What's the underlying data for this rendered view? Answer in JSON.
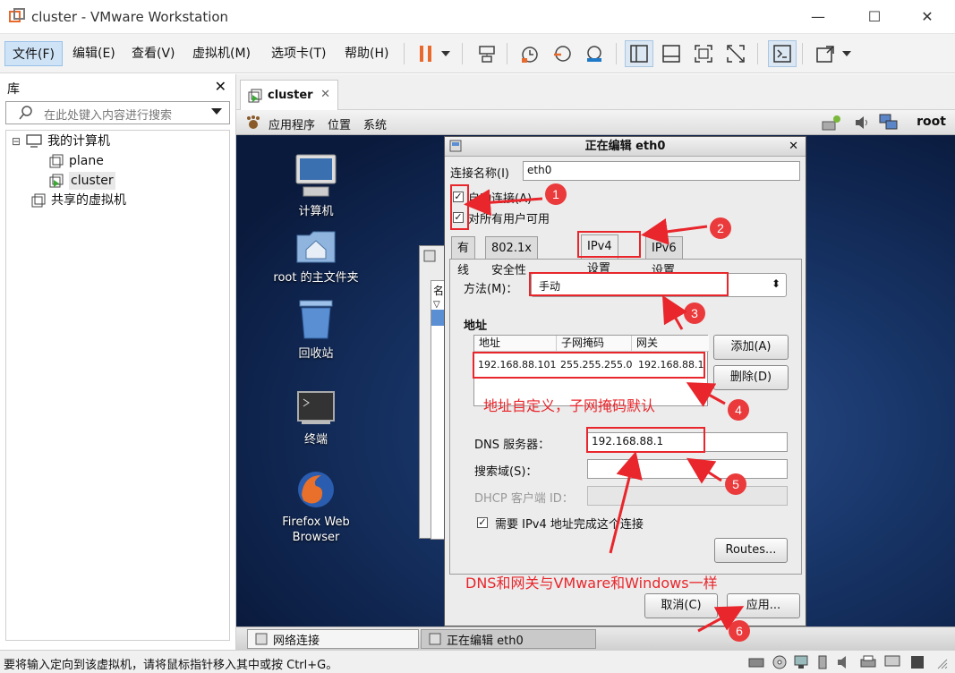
{
  "window": {
    "title": "cluster - VMware Workstation",
    "minimize": "—",
    "maximize": "☐",
    "close": "✕"
  },
  "menu": [
    "文件(F)",
    "编辑(E)",
    "查看(V)",
    "虚拟机(M)",
    "选项卡(T)",
    "帮助(H)"
  ],
  "library": {
    "title": "库",
    "close": "✕",
    "search_placeholder": "在此处键入内容进行搜索",
    "tree": {
      "root": "我的计算机",
      "collapse": "⊟",
      "vms": [
        "plane",
        "cluster"
      ],
      "shared": "共享的虚拟机"
    }
  },
  "vm_tab": {
    "label": "cluster",
    "close": "✕"
  },
  "guest": {
    "panel_menus": [
      "应用程序",
      "位置",
      "系统"
    ],
    "user": "root",
    "desktop_icons": [
      {
        "label": "计算机"
      },
      {
        "label": "root 的主文件夹"
      },
      {
        "label": "回收站"
      },
      {
        "label": "终端"
      },
      {
        "label": "Firefox Web\nBrowser"
      }
    ],
    "taskbar": [
      "网络连接",
      "正在编辑 eth0"
    ]
  },
  "bg_dialog": {
    "col_label": "名",
    "arrow": "▽"
  },
  "dialog": {
    "title": "正在编辑  eth0",
    "close": "✕",
    "conn_name_label": "连接名称(I)",
    "conn_name_value": "eth0",
    "auto_connect": "自动连接(A)",
    "all_users": "对所有用户可用",
    "tabs": [
      "有线",
      "802.1x 安全性",
      "IPv4 设置",
      "IPv6 设置"
    ],
    "method_label": "方法(M)：",
    "method_value": "手动",
    "combo_arrow": "⬍",
    "address_header": "地址",
    "columns": [
      "地址",
      "子网掩码",
      "网关"
    ],
    "row": [
      "192.168.88.101",
      "255.255.255.0",
      "192.168.88.1"
    ],
    "add_button": "添加(A)",
    "delete_button": "删除(D)",
    "dns_label": "DNS 服务器：",
    "dns_value": "192.168.88.1",
    "search_domain_label": "搜索域(S)：",
    "dhcp_label": "DHCP 客户端 ID：",
    "require_ipv4": "需要 IPv4 地址完成这个连接",
    "checkmark": "✓",
    "routes_button": "Routes...",
    "cancel_button": "取消(C)",
    "apply_button": "应用..."
  },
  "annotations": {
    "numbers": [
      "1",
      "2",
      "3",
      "4",
      "5",
      "6"
    ],
    "address_note": "地址自定义，子网掩码默认",
    "dns_note": "DNS和网关与VMware和Windows一样"
  },
  "status": {
    "message": "要将输入定向到该虚拟机，请将鼠标指针移入其中或按 Ctrl+G。"
  },
  "colors": {
    "annotation_red": "#e8262c",
    "pause_orange": "#e8692c",
    "menu_active": "#cfe3f7"
  }
}
